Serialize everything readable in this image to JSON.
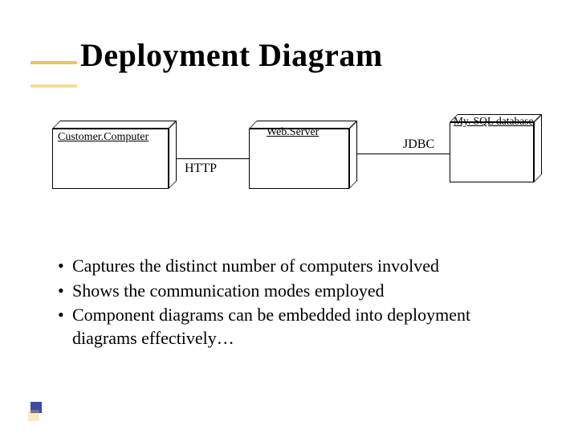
{
  "title": "Deployment Diagram",
  "diagram": {
    "nodes": [
      {
        "id": "customer-computer",
        "label": "Customer.Computer"
      },
      {
        "id": "web-server",
        "label": "Web.Server"
      },
      {
        "id": "mysql-database",
        "label": "My. SQL database"
      }
    ],
    "connections": [
      {
        "from": "customer-computer",
        "to": "web-server",
        "label": "HTTP"
      },
      {
        "from": "web-server",
        "to": "mysql-database",
        "label": "JDBC"
      }
    ]
  },
  "bullets": [
    "Captures the distinct number of computers involved",
    "Shows the communication modes employed",
    "Component diagrams can be embedded into deployment diagrams effectively…"
  ]
}
